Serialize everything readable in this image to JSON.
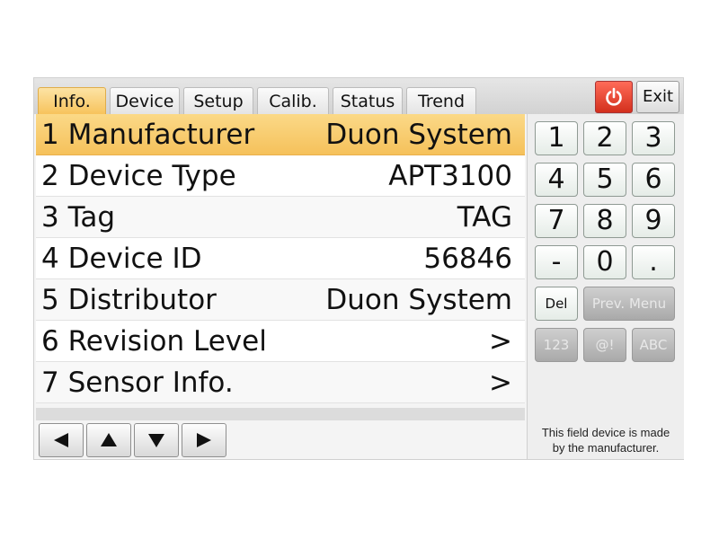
{
  "tabs": [
    {
      "label": "Info.",
      "active": true
    },
    {
      "label": "Device",
      "active": false
    },
    {
      "label": "Setup",
      "active": false
    },
    {
      "label": "Calib.",
      "active": false
    },
    {
      "label": "Status",
      "active": false
    },
    {
      "label": "Trend",
      "active": false
    }
  ],
  "header": {
    "power_icon": "power-icon",
    "exit_label": "Exit"
  },
  "menu": [
    {
      "label": "1 Manufacturer",
      "value": "Duon System",
      "selected": true
    },
    {
      "label": "2 Device Type",
      "value": "APT3100",
      "selected": false
    },
    {
      "label": "3 Tag",
      "value": "TAG",
      "selected": false
    },
    {
      "label": "4 Device ID",
      "value": "56846",
      "selected": false
    },
    {
      "label": "5 Distributor",
      "value": "Duon System",
      "selected": false
    },
    {
      "label": "6 Revision Level",
      "value": ">",
      "selected": false
    },
    {
      "label": "7 Sensor Info.",
      "value": ">",
      "selected": false
    }
  ],
  "nav": {
    "left_icon": "arrow-left-icon",
    "up_icon": "arrow-up-icon",
    "down_icon": "arrow-down-icon",
    "right_icon": "arrow-right-icon"
  },
  "keypad": {
    "keys": [
      "1",
      "2",
      "3",
      "4",
      "5",
      "6",
      "7",
      "8",
      "9",
      "-",
      "0",
      "."
    ],
    "del_label": "Del",
    "prev_menu_label": "Prev. Menu",
    "mode_keys": [
      "123",
      "@!",
      "ABC"
    ]
  },
  "help_text_line1": "This field device is made",
  "help_text_line2": "by the manufacturer.",
  "colors": {
    "selected_row": "#f7c35c",
    "power_button": "#e03a26"
  }
}
